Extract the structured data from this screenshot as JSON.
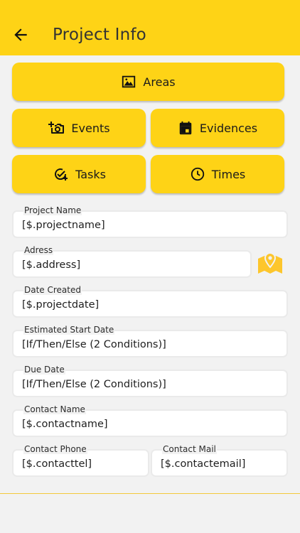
{
  "header": {
    "title": "Project Info",
    "background": "#fed316"
  },
  "buttons": {
    "areas": "Areas",
    "events": "Events",
    "evidences": "Evidences",
    "tasks": "Tasks",
    "times": "Times"
  },
  "fields": {
    "project_name": {
      "label": "Project Name",
      "value": "[$.projectname]"
    },
    "address": {
      "label": "Adress",
      "value": "[$.address]"
    },
    "date_created": {
      "label": "Date Created",
      "value": "[$.projectdate]"
    },
    "estimated_start": {
      "label": "Estimated Start Date",
      "value": "[If/Then/Else (2 Conditions)]"
    },
    "due_date": {
      "label": "Due Date",
      "value": "[If/Then/Else (2 Conditions)]"
    },
    "contact_name": {
      "label": "Contact Name",
      "value": "[$.contactname]"
    },
    "contact_phone": {
      "label": "Contact Phone",
      "value": "[$.contacttel]"
    },
    "contact_mail": {
      "label": "Contact Mail",
      "value": "[$.contactemail]"
    }
  },
  "icons": {
    "back": "arrow-left-icon",
    "areas": "landscape-icon",
    "events": "add-photo-icon",
    "evidences": "calendar-icon",
    "tasks": "task-add-icon",
    "times": "clock-icon",
    "map": "map-pin-icon"
  },
  "colors": {
    "accent": "#fed316",
    "field_border": "#eaeaea",
    "page_bg": "#f2f2f2"
  }
}
